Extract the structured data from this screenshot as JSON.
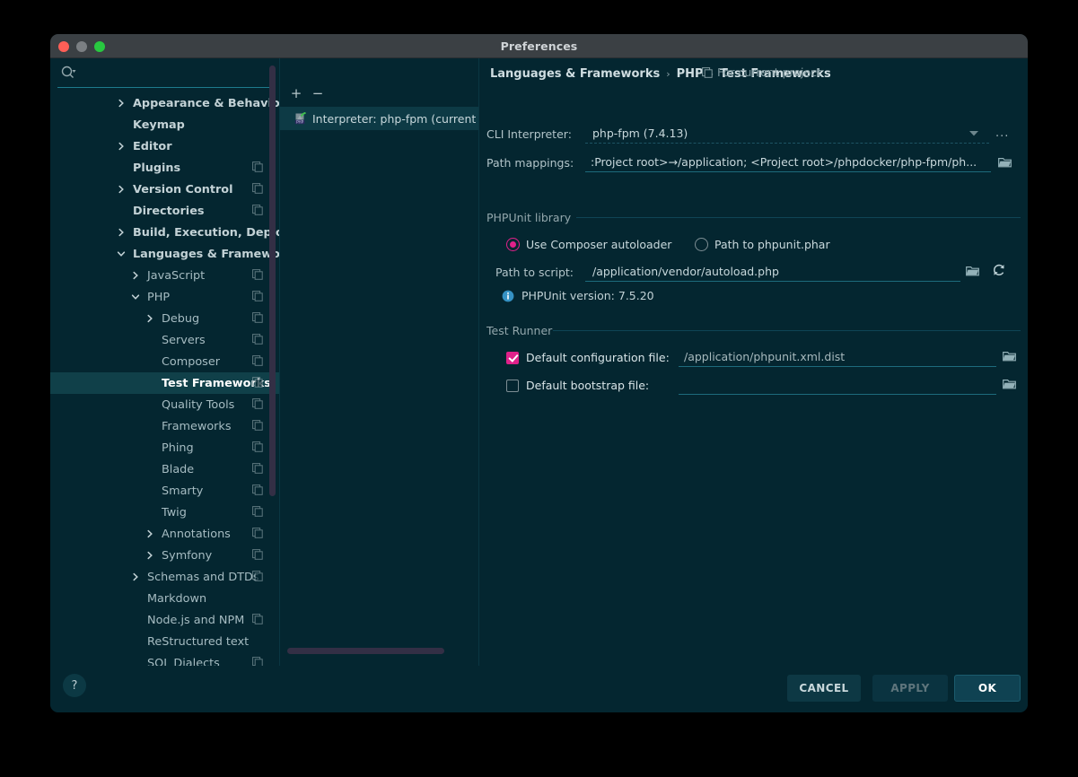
{
  "window": {
    "title": "Preferences"
  },
  "search": {
    "value": "",
    "placeholder": "",
    "icon": "search-icon"
  },
  "sidebar": {
    "items": [
      {
        "label": "Appearance & Behavior",
        "depth": 0,
        "arrow": "collapsed",
        "copy": false,
        "selected": false
      },
      {
        "label": "Keymap",
        "depth": 0,
        "arrow": "none",
        "copy": false,
        "selected": false
      },
      {
        "label": "Editor",
        "depth": 0,
        "arrow": "collapsed",
        "copy": false,
        "selected": false
      },
      {
        "label": "Plugins",
        "depth": 0,
        "arrow": "none",
        "copy": true,
        "selected": false
      },
      {
        "label": "Version Control",
        "depth": 0,
        "arrow": "collapsed",
        "copy": true,
        "selected": false
      },
      {
        "label": "Directories",
        "depth": 0,
        "arrow": "none",
        "copy": true,
        "selected": false
      },
      {
        "label": "Build, Execution, Deployment",
        "depth": 0,
        "arrow": "collapsed",
        "copy": false,
        "selected": false
      },
      {
        "label": "Languages & Frameworks",
        "depth": 0,
        "arrow": "expanded",
        "copy": false,
        "selected": false
      },
      {
        "label": "JavaScript",
        "depth": 1,
        "arrow": "collapsed",
        "copy": true,
        "selected": false
      },
      {
        "label": "PHP",
        "depth": 1,
        "arrow": "expanded",
        "copy": true,
        "selected": false
      },
      {
        "label": "Debug",
        "depth": 2,
        "arrow": "collapsed",
        "copy": true,
        "selected": false
      },
      {
        "label": "Servers",
        "depth": 2,
        "arrow": "none",
        "copy": true,
        "selected": false
      },
      {
        "label": "Composer",
        "depth": 2,
        "arrow": "none",
        "copy": true,
        "selected": false
      },
      {
        "label": "Test Frameworks",
        "depth": 2,
        "arrow": "none",
        "copy": true,
        "selected": true
      },
      {
        "label": "Quality Tools",
        "depth": 2,
        "arrow": "none",
        "copy": true,
        "selected": false
      },
      {
        "label": "Frameworks",
        "depth": 2,
        "arrow": "none",
        "copy": true,
        "selected": false
      },
      {
        "label": "Phing",
        "depth": 2,
        "arrow": "none",
        "copy": true,
        "selected": false
      },
      {
        "label": "Blade",
        "depth": 2,
        "arrow": "none",
        "copy": true,
        "selected": false
      },
      {
        "label": "Smarty",
        "depth": 2,
        "arrow": "none",
        "copy": true,
        "selected": false
      },
      {
        "label": "Twig",
        "depth": 2,
        "arrow": "none",
        "copy": true,
        "selected": false
      },
      {
        "label": "Annotations",
        "depth": 2,
        "arrow": "collapsed",
        "copy": true,
        "selected": false
      },
      {
        "label": "Symfony",
        "depth": 2,
        "arrow": "collapsed",
        "copy": true,
        "selected": false
      },
      {
        "label": "Schemas and DTDs",
        "depth": 1,
        "arrow": "collapsed",
        "copy": true,
        "selected": false
      },
      {
        "label": "Markdown",
        "depth": 1,
        "arrow": "none",
        "copy": false,
        "selected": false
      },
      {
        "label": "Node.js and NPM",
        "depth": 1,
        "arrow": "none",
        "copy": true,
        "selected": false
      },
      {
        "label": "ReStructured text",
        "depth": 1,
        "arrow": "none",
        "copy": false,
        "selected": false
      },
      {
        "label": "SOL Dialects",
        "depth": 1,
        "arrow": "none",
        "copy": true,
        "selected": false
      }
    ]
  },
  "interpreter_panel": {
    "add_label": "+",
    "remove_label": "−",
    "rows": [
      {
        "label": "Interpreter: php-fpm (current p",
        "icon": "php-interpreter-icon"
      }
    ]
  },
  "breadcrumb": {
    "items": [
      "Languages & Frameworks",
      "PHP",
      "Test Frameworks"
    ],
    "separator": "›"
  },
  "scope": {
    "label": "For current project",
    "icon": "copy-icon"
  },
  "cli_interpreter": {
    "label": "CLI Interpreter:",
    "value": "php-fpm (7.4.13)",
    "dropdown_icon": "chevron-down-icon",
    "more_label": "..."
  },
  "path_mappings": {
    "label": "Path mappings:",
    "value": ":Project root>→/application; <Project root>/phpdocker/php-fpm/ph...",
    "browse_icon": "folder-icon"
  },
  "phpunit_library": {
    "group_label": "PHPUnit library",
    "options": [
      {
        "label": "Use Composer autoloader",
        "selected": true
      },
      {
        "label": "Path to phpunit.phar",
        "selected": false
      }
    ],
    "path_to_script": {
      "label": "Path to script:",
      "value": "/application/vendor/autoload.php",
      "browse_icon": "folder-icon",
      "refresh_icon": "refresh-icon"
    },
    "version_info": {
      "icon": "info-icon",
      "text": "PHPUnit version: 7.5.20"
    }
  },
  "test_runner": {
    "group_label": "Test Runner",
    "rows": [
      {
        "label": "Default configuration file:",
        "checked": true,
        "value": "/application/phpunit.xml.dist",
        "browse_icon": "folder-icon"
      },
      {
        "label": "Default bootstrap file:",
        "checked": false,
        "value": "",
        "browse_icon": "folder-icon"
      }
    ]
  },
  "footer": {
    "help_label": "?",
    "cancel_label": "CANCEL",
    "apply_label": "APPLY",
    "ok_label": "OK"
  },
  "colors": {
    "window_bg": "#042630",
    "titlebar_bg": "#3b4044",
    "accent_pink": "#e0218a",
    "selection_bg": "#104049",
    "scrollbar": "#332f45",
    "underline": "#1d6b7c"
  }
}
